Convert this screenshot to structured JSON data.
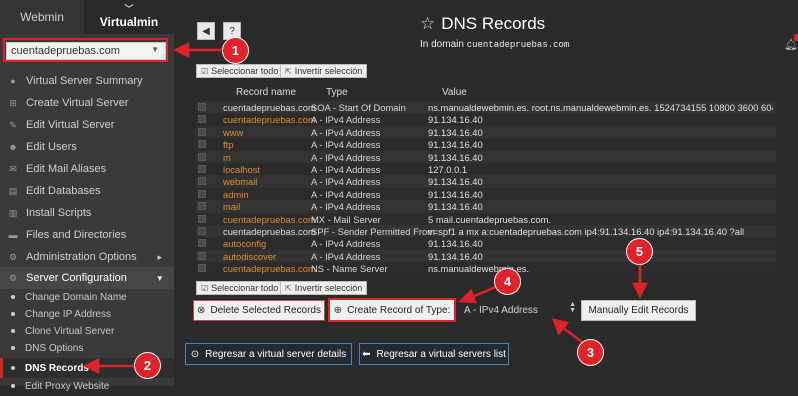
{
  "sidebar": {
    "tabs": {
      "webmin": "Webmin",
      "virtualmin": "Virtualmin"
    },
    "domain_select": "cuentadepruebas.com",
    "items": [
      {
        "label": "Virtual Server Summary",
        "icon": "info-icon"
      },
      {
        "label": "Create Virtual Server",
        "icon": "plus-square-icon"
      },
      {
        "label": "Edit Virtual Server",
        "icon": "edit-icon"
      },
      {
        "label": "Edit Users",
        "icon": "users-icon"
      },
      {
        "label": "Edit Mail Aliases",
        "icon": "envelope-icon"
      },
      {
        "label": "Edit Databases",
        "icon": "database-icon"
      },
      {
        "label": "Install Scripts",
        "icon": "script-icon"
      },
      {
        "label": "Files and Directories",
        "icon": "folder-icon"
      },
      {
        "label": "Administration Options",
        "icon": "gear-icon",
        "arrow": "▸"
      },
      {
        "label": "Server Configuration",
        "icon": "wrench-icon",
        "arrow": "▾"
      }
    ],
    "subitems": [
      "Change Domain Name",
      "Change IP Address",
      "Clone Virtual Server",
      "DNS Options",
      "DNS Records",
      "Edit Proxy Website"
    ]
  },
  "header": {
    "title": "DNS Records",
    "subtitle_prefix": "In domain",
    "subtitle_domain": "cuentadepruebas.com"
  },
  "table": {
    "select_all": "Seleccionar todo",
    "invert": "Invertir selección",
    "columns": [
      "Record name",
      "Type",
      "Value"
    ],
    "rows": [
      [
        "cuentadepruebas.com",
        "SOA - Start Of Domain",
        "ns.manualdewebmin.es. root.ns.manualdewebmin.es. 1524734155 10800 3600 6048"
      ],
      [
        "cuentadepruebas.com",
        "A - IPv4 Address",
        "91.134.16.40"
      ],
      [
        "www",
        "A - IPv4 Address",
        "91.134.16.40"
      ],
      [
        "ftp",
        "A - IPv4 Address",
        "91.134.16.40"
      ],
      [
        "m",
        "A - IPv4 Address",
        "91.134.16.40"
      ],
      [
        "localhost",
        "A - IPv4 Address",
        "127.0.0.1"
      ],
      [
        "webmail",
        "A - IPv4 Address",
        "91.134.16.40"
      ],
      [
        "admin",
        "A - IPv4 Address",
        "91.134.16.40"
      ],
      [
        "mail",
        "A - IPv4 Address",
        "91.134.16.40"
      ],
      [
        "cuentadepruebas.com",
        "MX - Mail Server",
        "5 mail.cuentadepruebas.com."
      ],
      [
        "cuentadepruebas.com",
        "SPF - Sender Permitted From",
        "v=spf1 a mx a:cuentadepruebas.com ip4:91.134.16.40 ip4:91.134.16.40 ?all"
      ],
      [
        "autoconfig",
        "A - IPv4 Address",
        "91.134.16.40"
      ],
      [
        "autodiscover",
        "A - IPv4 Address",
        "91.134.16.40"
      ],
      [
        "cuentadepruebas.com",
        "NS - Name Server",
        "ns.manualdewebmin.es."
      ]
    ]
  },
  "actions": {
    "delete": "Delete Selected Records",
    "create": "Create Record of Type:",
    "type_value": "A - IPv4 Address",
    "manual": "Manually Edit Records"
  },
  "nav": {
    "back_details": "Regresar a virtual server details",
    "back_list": "Regresar a virtual servers list"
  },
  "annotations": [
    "1",
    "2",
    "3",
    "4",
    "5"
  ],
  "colors": {
    "annotation": "#e0222a",
    "link": "#e28b2d",
    "nav_border": "#4b86b4"
  }
}
